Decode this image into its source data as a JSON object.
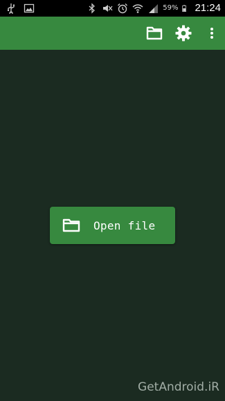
{
  "status_bar": {
    "battery_percent": "59%",
    "time": "21:24",
    "left_icons": [
      "usb-icon",
      "image-icon"
    ],
    "right_icons": [
      "bluetooth-icon",
      "mute-icon",
      "alarm-icon",
      "wifi-icon",
      "signal-icon",
      "battery-icon"
    ]
  },
  "app_bar": {
    "background_color": "#37893f",
    "actions": [
      "folder-icon",
      "settings-gear-icon",
      "more-vertical-icon"
    ]
  },
  "main": {
    "background_color": "#1b2b21",
    "open_file_button": {
      "label": "Open file",
      "icon": "folder-icon",
      "color": "#37893f"
    }
  },
  "watermark": {
    "text": "GetAndroid.iR"
  }
}
